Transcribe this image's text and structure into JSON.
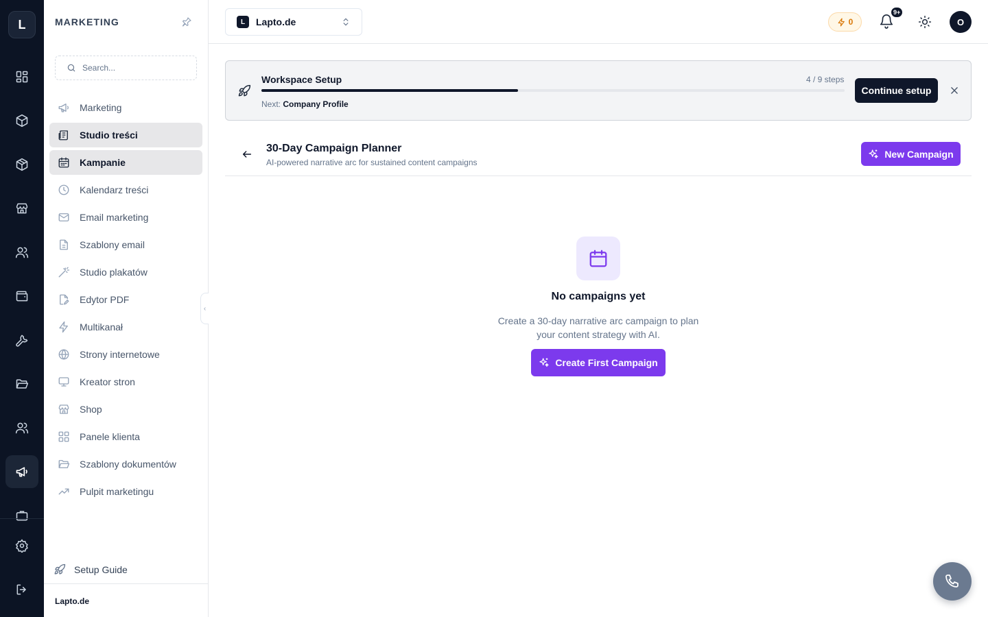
{
  "rail": {
    "logo_letter": "L",
    "items": [
      {
        "name": "grid-icon"
      },
      {
        "name": "box-icon"
      },
      {
        "name": "package-icon"
      },
      {
        "name": "store-icon"
      },
      {
        "name": "users-icon"
      },
      {
        "name": "wallet-icon"
      },
      {
        "name": "wrench-icon"
      },
      {
        "name": "folder-icon"
      },
      {
        "name": "team-icon"
      },
      {
        "name": "megaphone-icon",
        "active": true
      },
      {
        "name": "briefcase-icon"
      }
    ],
    "bottom": [
      {
        "name": "settings-icon"
      },
      {
        "name": "logout-icon"
      }
    ]
  },
  "sidebar": {
    "heading": "MARKETING",
    "search_placeholder": "Search...",
    "items": [
      {
        "label": "Marketing",
        "icon": "megaphone-icon"
      },
      {
        "label": "Studio treści",
        "icon": "newspaper-icon",
        "active": true
      },
      {
        "label": "Kampanie",
        "icon": "calendar-icon",
        "active": true
      },
      {
        "label": "Kalendarz treści",
        "icon": "clock-icon"
      },
      {
        "label": "Email marketing",
        "icon": "mail-icon"
      },
      {
        "label": "Szablony email",
        "icon": "file-text-icon"
      },
      {
        "label": "Studio plakatów",
        "icon": "wand-icon"
      },
      {
        "label": "Edytor PDF",
        "icon": "file-edit-icon"
      },
      {
        "label": "Multikanał",
        "icon": "zap-icon"
      },
      {
        "label": "Strony internetowe",
        "icon": "globe-icon"
      },
      {
        "label": "Kreator stron",
        "icon": "monitor-icon"
      },
      {
        "label": "Shop",
        "icon": "store-icon"
      },
      {
        "label": "Panele klienta",
        "icon": "grid-icon"
      },
      {
        "label": "Szablony dokumentów",
        "icon": "folder-icon"
      },
      {
        "label": "Pulpit marketingu",
        "icon": "trending-up-icon"
      }
    ],
    "setup_guide": "Setup Guide",
    "footer": "Lapto.de"
  },
  "topbar": {
    "workspace_letter": "L",
    "workspace_name": "Lapto.de",
    "credits": "0",
    "notifications_badge": "9+",
    "avatar_letter": "O"
  },
  "setup": {
    "title": "Workspace Setup",
    "steps": "4 / 9 steps",
    "progress": 0.44,
    "next_prefix": "Next:",
    "next_step": "Company Profile",
    "button": "Continue setup"
  },
  "page": {
    "title": "30-Day Campaign Planner",
    "subtitle": "AI-powered narrative arc for sustained content campaigns",
    "new_button": "New Campaign"
  },
  "empty": {
    "title": "No campaigns yet",
    "description": "Create a 30-day narrative arc campaign to plan your content strategy with AI.",
    "button": "Create First Campaign"
  },
  "colors": {
    "rail_bg": "#0c1424",
    "accent": "#7c3aed",
    "primary_dark": "#0f172a",
    "credits": "#d97706"
  }
}
